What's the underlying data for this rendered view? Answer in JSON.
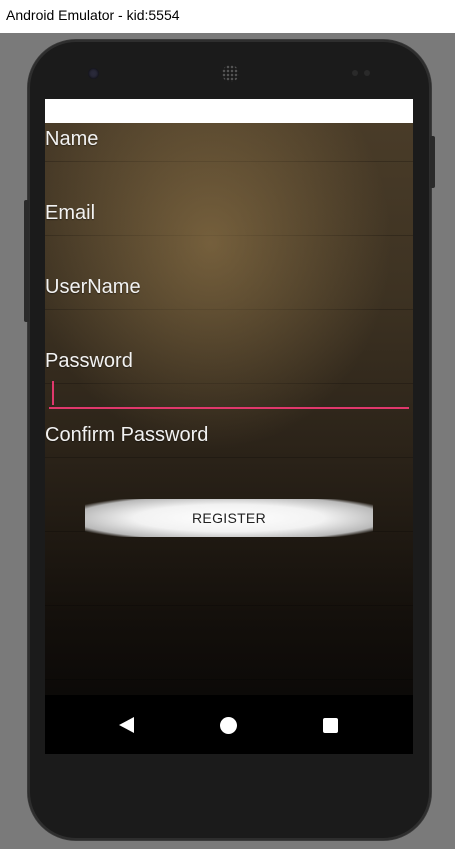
{
  "window": {
    "title": "Android Emulator - kid:5554"
  },
  "form": {
    "fields": [
      {
        "label": "Name",
        "value": ""
      },
      {
        "label": "Email",
        "value": ""
      },
      {
        "label": "UserName",
        "value": ""
      },
      {
        "label": "Password",
        "value": "",
        "focused": true
      },
      {
        "label": "Confirm Password",
        "value": ""
      }
    ],
    "register_label": "REGISTER"
  },
  "navbar": {
    "icons": [
      "back-icon",
      "home-icon",
      "recents-icon"
    ]
  },
  "colors": {
    "accent": "#e0386c",
    "navbar": "#000000",
    "label_text": "#f2f2f2"
  }
}
